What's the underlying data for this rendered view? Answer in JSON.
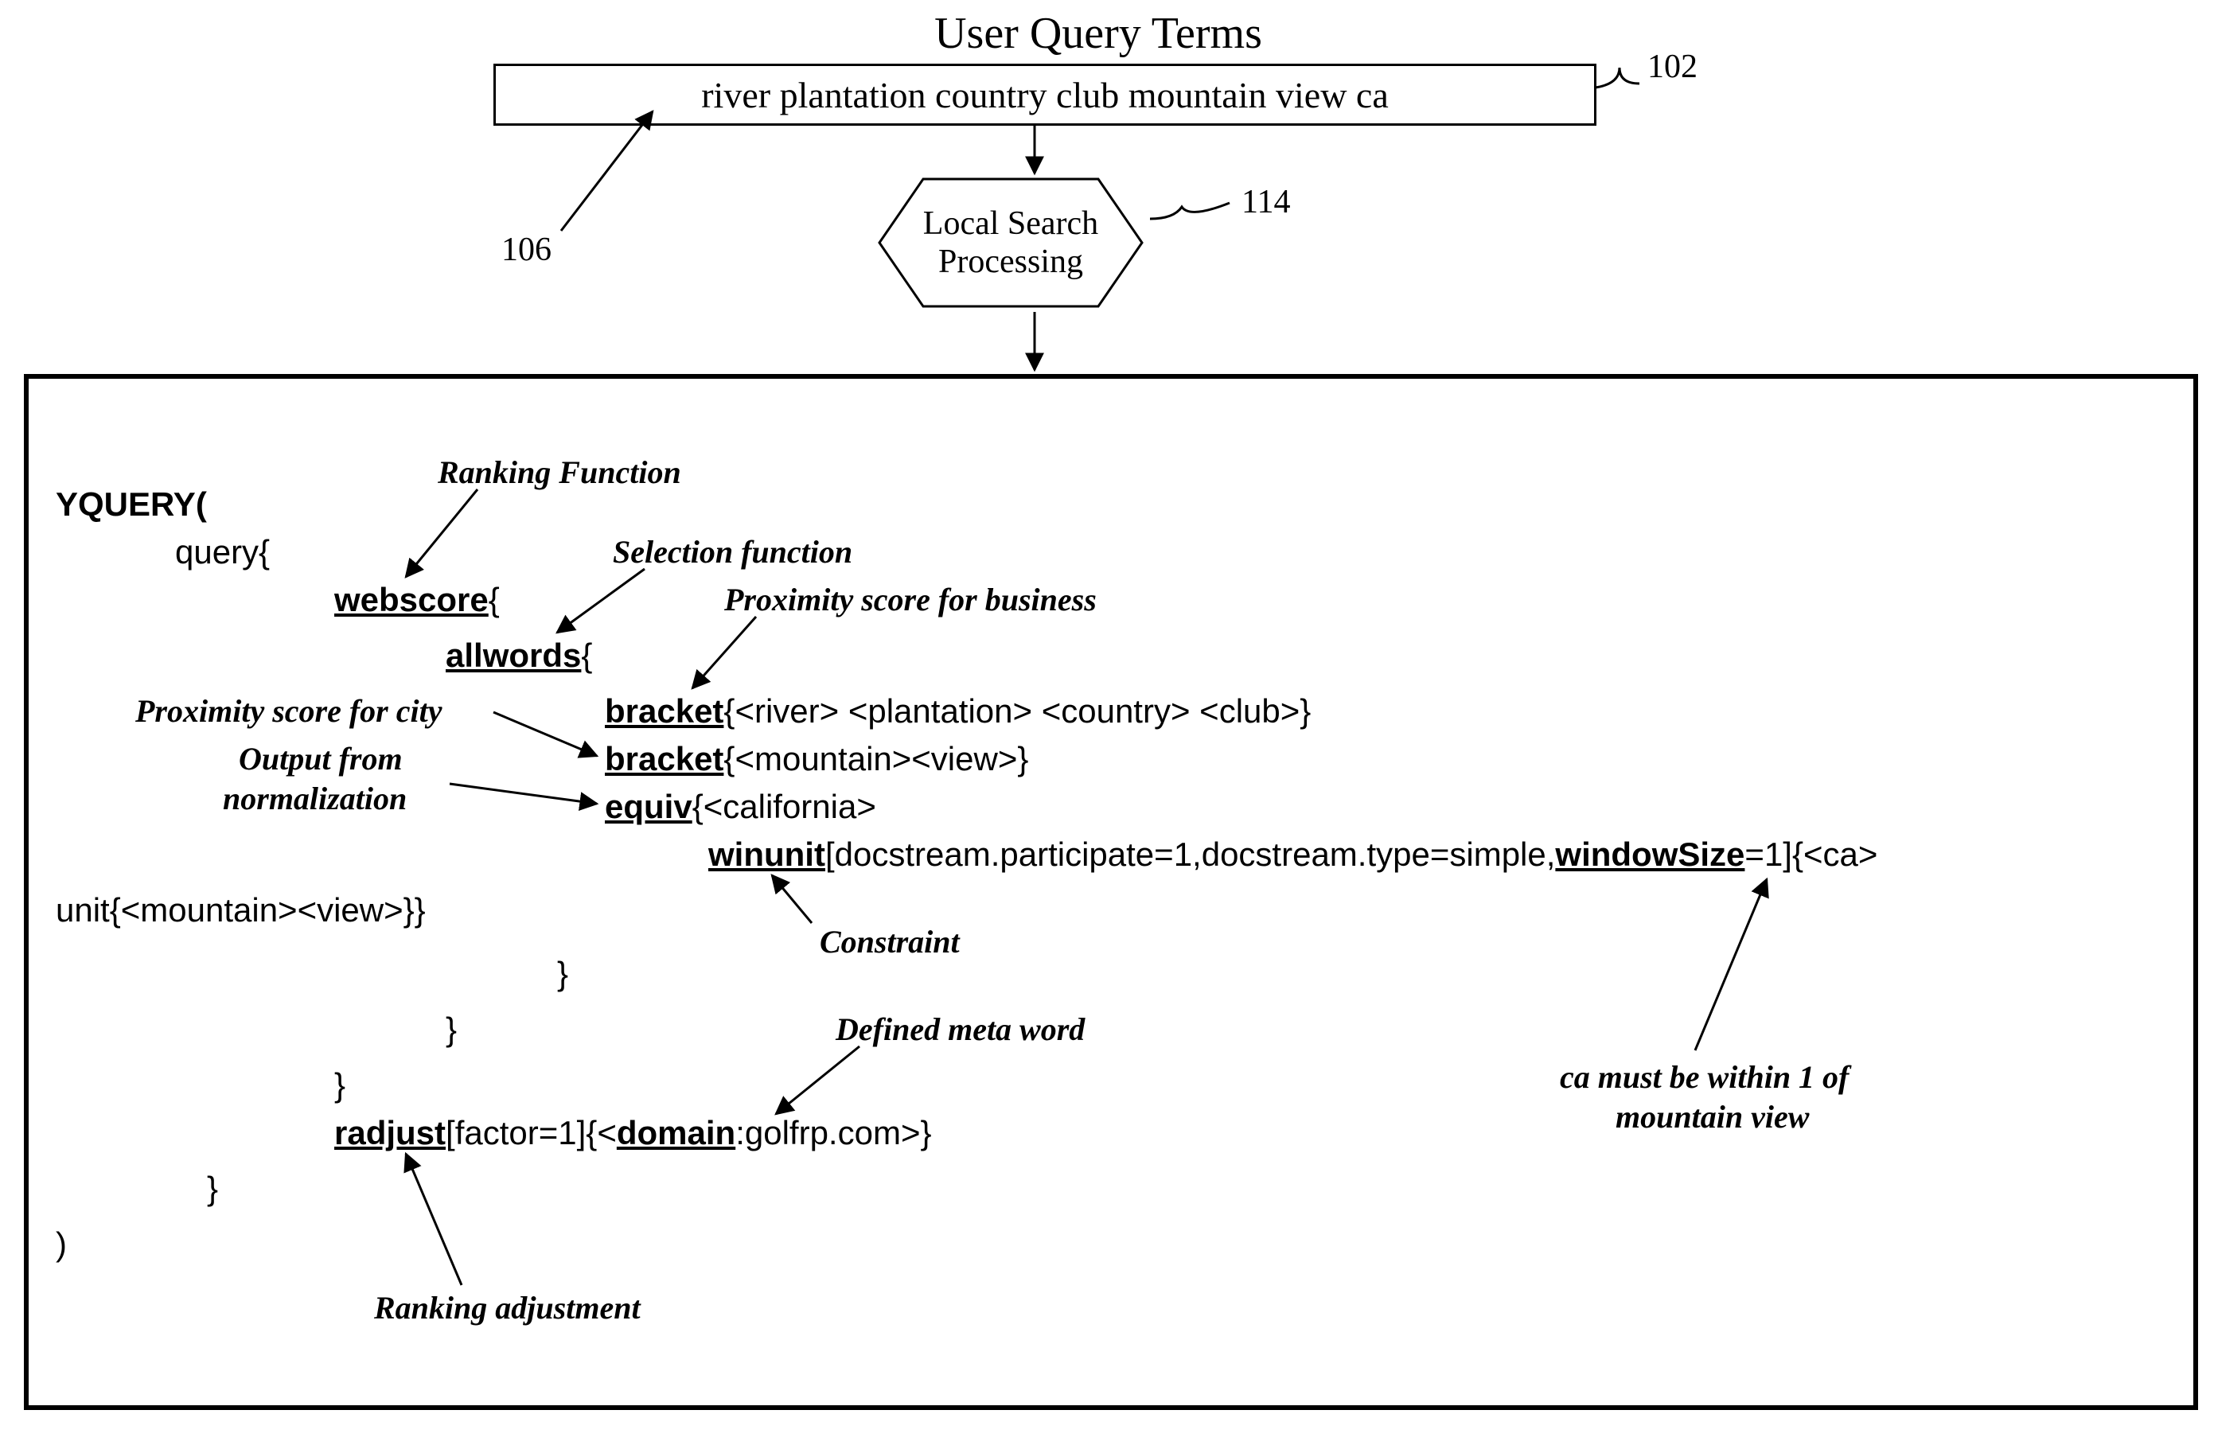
{
  "title": "User  Query Terms",
  "query_box": "river plantation country club mountain view ca",
  "hex_label_line1": "Local Search",
  "hex_label_line2": "Processing",
  "ref_102": "102",
  "ref_106": "106",
  "ref_114": "114",
  "yquery": {
    "head": "YQUERY(",
    "query_line": "query{",
    "webscore": "webscore",
    "allwords": "allwords",
    "bracket": "bracket",
    "bracket1_tail": "{<river> <plantation> <country> <club>}",
    "bracket2_tail": "{<mountain><view>}",
    "equiv": "equiv",
    "equiv_tail": "{<california>",
    "winunit": "winunit",
    "winunit_mid": "[docstream.participate=1,docstream.type=simple,",
    "windowSize": "windowSize",
    "winunit_end": "=1]{<ca>",
    "unit_line": "unit{<mountain><view>}}",
    "close1": "}",
    "close2": "}",
    "close3": "}",
    "radjust": "radjust",
    "radjust_mid": "[factor=1]{<",
    "domain": "domain",
    "radjust_end": ":golfrp.com>}",
    "close4": "}",
    "close_paren": ")",
    "open_brace": "{"
  },
  "labels": {
    "ranking_function": "Ranking Function",
    "selection_function": "Selection function",
    "proximity_business": "Proximity score for business",
    "proximity_city": "Proximity score for city",
    "output_norm1": "Output from",
    "output_norm2": "normalization",
    "constraint": "Constraint",
    "defined_meta": "Defined meta word",
    "ca_within1": "ca must be within 1 of",
    "ca_within2": "mountain view",
    "ranking_adj": "Ranking adjustment"
  }
}
